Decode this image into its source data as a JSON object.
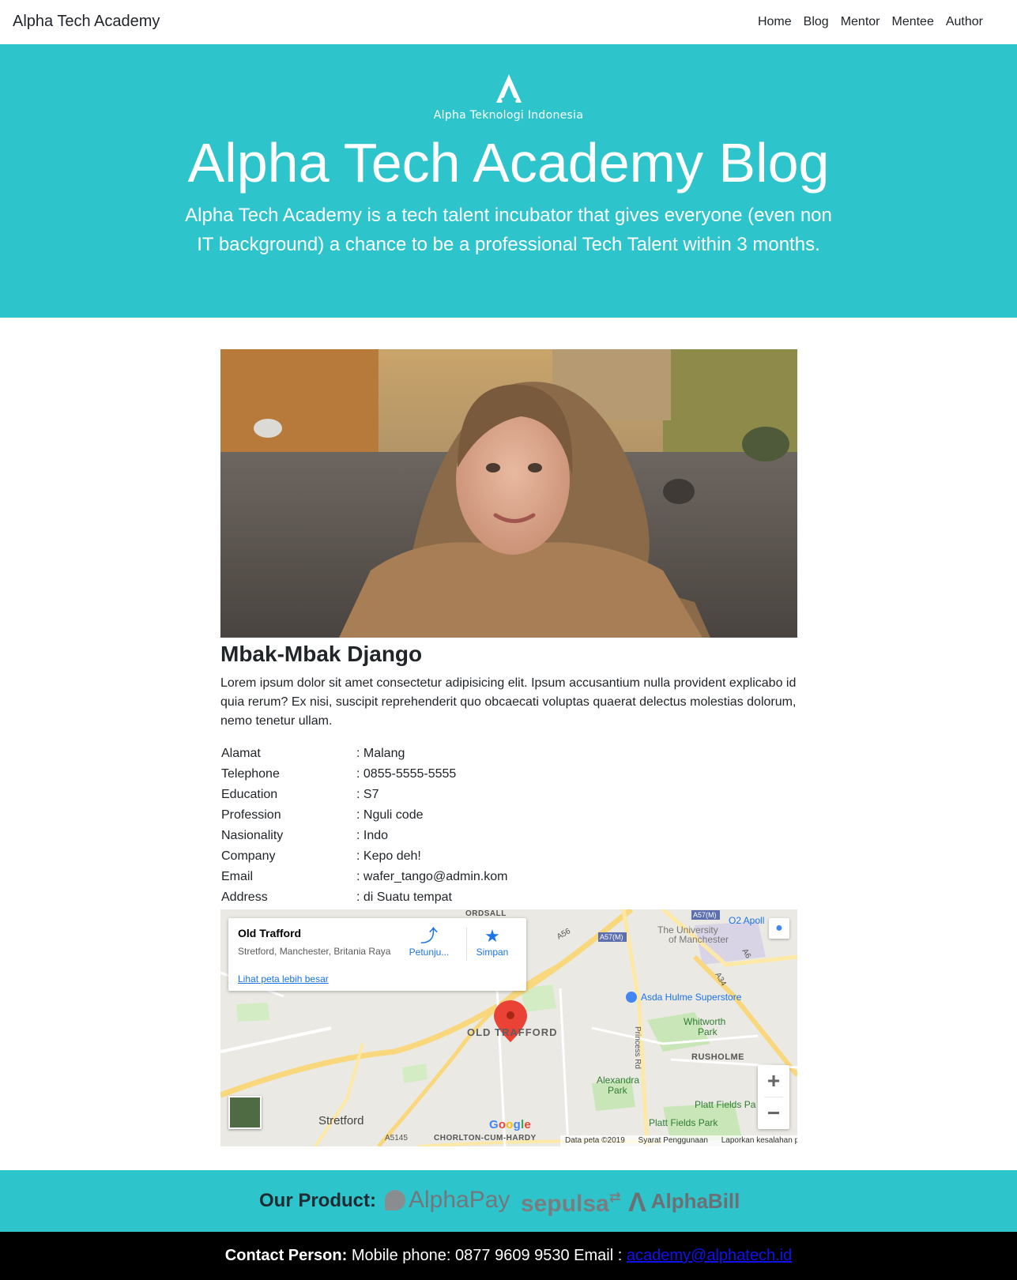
{
  "navbar": {
    "brand": "Alpha Tech Academy",
    "links": [
      "Home",
      "Blog",
      "Mentor",
      "Mentee",
      "Author"
    ]
  },
  "hero": {
    "logo_text": "Alpha Teknologi Indonesia",
    "title": "Alpha Tech Academy Blog",
    "lead": "Alpha Tech Academy is a tech talent incubator that gives everyone (even non IT background) a chance to be a professional Tech Talent within 3 months."
  },
  "profile": {
    "name": "Mbak-Mbak Django",
    "bio": "Lorem ipsum dolor sit amet consectetur adipisicing elit. Ipsum accusantium nulla provident explicabo id quia rerum? Ex nisi, suscipit reprehenderit quo obcaecati voluptas quaerat delectus molestias dolorum, nemo tenetur ullam.",
    "details": [
      {
        "key": "Alamat",
        "value": ": Malang"
      },
      {
        "key": "Telephone",
        "value": ": 0855-5555-5555"
      },
      {
        "key": "Education",
        "value": ": S7"
      },
      {
        "key": "Profession",
        "value": ": Nguli code"
      },
      {
        "key": "Nasionality",
        "value": ": Indo"
      },
      {
        "key": "Company",
        "value": ": Kepo deh!"
      },
      {
        "key": "Email",
        "value": ": wafer_tango@admin.kom"
      },
      {
        "key": "Address",
        "value": ": di Suatu tempat"
      }
    ]
  },
  "map": {
    "place_name": "Old Trafford",
    "place_address": "Stretford, Manchester, Britania Raya",
    "larger_map_link": "Lihat peta lebih besar",
    "directions_label": "Petunju...",
    "save_label": "Simpan",
    "labels": {
      "old_trafford": "OLD TRAFFORD",
      "stretford": "Stretford",
      "chorlton": "CHORLTON-CUM-HARDY",
      "rusholme": "RUSHOLME",
      "whitworth": "Whitworth",
      "whitworth2": "Park",
      "alexandra": "Alexandra",
      "alexandra2": "Park",
      "asda": "Asda Hulme Superstore",
      "university": "The University",
      "university2": "of Manchester",
      "platt": "Platt Fields Park",
      "platt2": "Platt Fields Pa",
      "o2": "O2 Apoll",
      "ordsall": "ORDSALL",
      "princess": "Princess Rd",
      "a56": "A56",
      "a57m": "A57(M)",
      "a5145": "A5145",
      "a34": "A34",
      "a6": "A6",
      "google": "Google"
    },
    "attribution": {
      "data": "Data peta ©2019",
      "terms": "Syarat Penggunaan",
      "report": "Laporkan kesalahan peta"
    }
  },
  "products": {
    "label": "Our Product:",
    "items": [
      "AlphaPay",
      "sepulsa",
      "AlphaBill"
    ]
  },
  "contact": {
    "label": "Contact Person:",
    "text": "Mobile phone: 0877 9609 9530 Email :",
    "email": "academy@alphatech.id"
  },
  "colors": {
    "teal": "#2ec4cc",
    "footer_black": "#000000",
    "link_blue": "#1a73e8"
  }
}
